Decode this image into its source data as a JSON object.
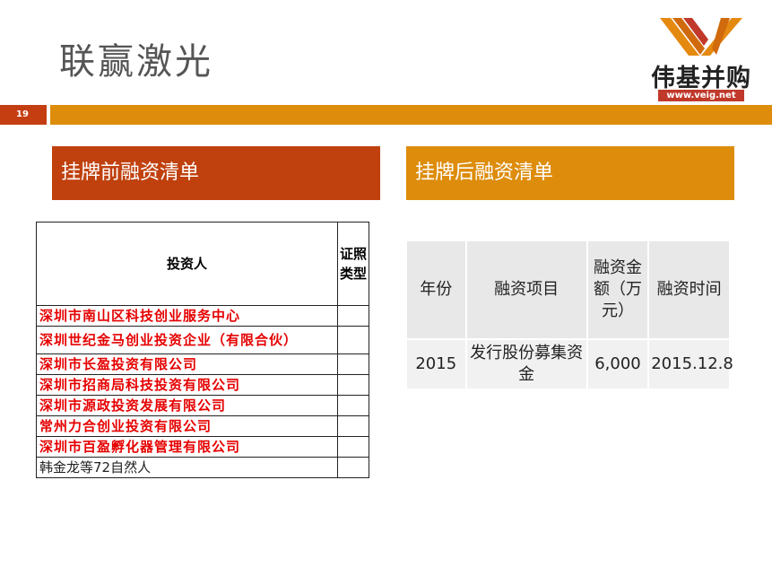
{
  "title": "联赢激光",
  "logo": {
    "name": "伟基并购",
    "url": "www.veig.net"
  },
  "page_number": "19",
  "section_left": {
    "title": "挂牌前融资清单"
  },
  "section_right": {
    "title": "挂牌后融资清单"
  },
  "investors_table": {
    "headers": {
      "investor": "投资人",
      "type": "证照类型"
    },
    "rows": [
      {
        "name": "深圳市南山区科技创业服务中心",
        "type": "",
        "highlight": true
      },
      {
        "name": "深圳世纪金马创业投资企业（有限合伙）",
        "type": "",
        "highlight": true
      },
      {
        "name": "深圳市长盈投资有限公司",
        "type": "",
        "highlight": true
      },
      {
        "name": "深圳市招商局科技投资有限公司",
        "type": "",
        "highlight": true
      },
      {
        "name": "深圳市源政投资发展有限公司",
        "type": "",
        "highlight": true
      },
      {
        "name": "常州力合创业投资有限公司",
        "type": "",
        "highlight": true
      },
      {
        "name": "深圳市百盈孵化器管理有限公司",
        "type": "",
        "highlight": true
      },
      {
        "name": "韩金龙等72自然人",
        "type": "",
        "highlight": false
      }
    ]
  },
  "financing_table": {
    "headers": [
      "年份",
      "融资项目",
      "融资金额（万元）",
      "融资时间"
    ],
    "rows": [
      [
        "2015",
        "发行股份募集资金",
        "6,000",
        "2015.12.8"
      ]
    ]
  },
  "colors": {
    "accent_red": "#c0410e",
    "accent_orange": "#dd8c0c",
    "text_red": "#e60000"
  }
}
